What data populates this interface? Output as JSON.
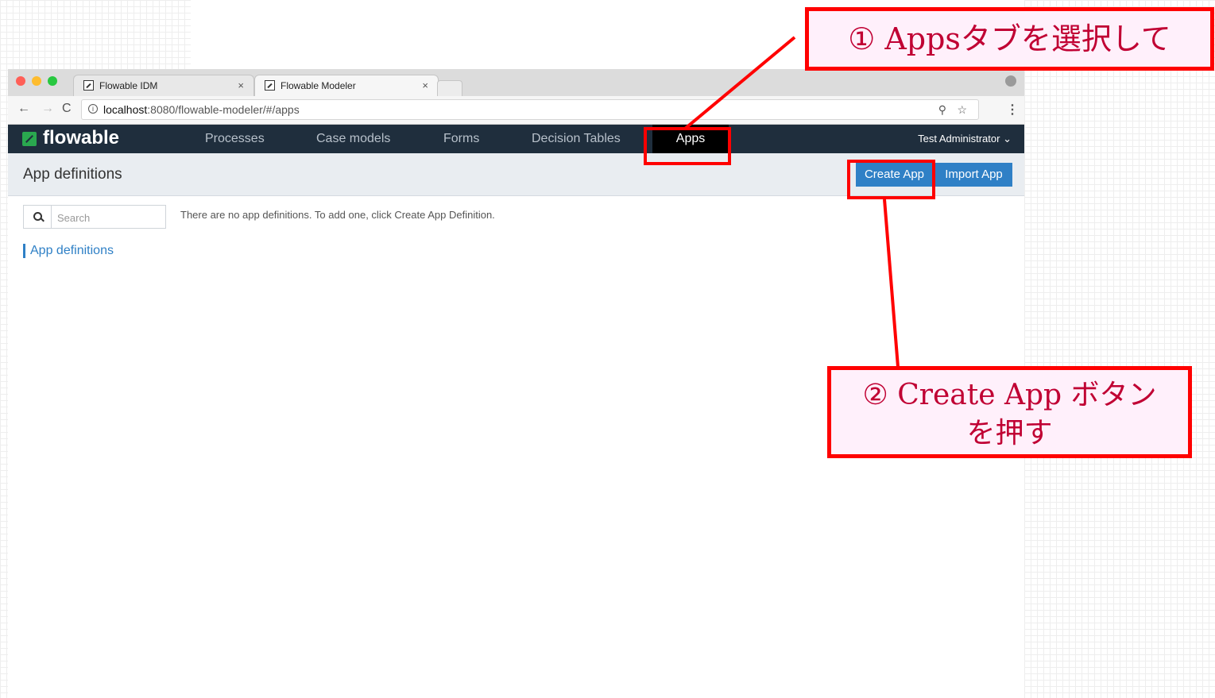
{
  "browser": {
    "tabs": [
      {
        "title": "Flowable IDM",
        "close": "×"
      },
      {
        "title": "Flowable Modeler",
        "close": "×"
      }
    ],
    "address": {
      "host": "localhost",
      "path": ":8080/flowable-modeler/#/apps"
    }
  },
  "navbar": {
    "logo": "flowable",
    "items": [
      "Processes",
      "Case models",
      "Forms",
      "Decision Tables",
      "Apps"
    ],
    "active": "Apps",
    "user": "Test Administrator"
  },
  "subheader": {
    "title": "App definitions",
    "create_label": "Create App",
    "import_label": "Import App"
  },
  "content": {
    "search_placeholder": "Search",
    "empty_message": "There are no app definitions. To add one, click Create App Definition.",
    "section_label": "App definitions"
  },
  "annotations": {
    "step1": "① Appsタブを選択して",
    "step2_line1": "② Create App ボタン",
    "step2_line2": "を押す"
  },
  "colors": {
    "navbar_bg": "#1f2e3d",
    "primary_button": "#2f80c6",
    "annotation_red": "#ff0000"
  }
}
